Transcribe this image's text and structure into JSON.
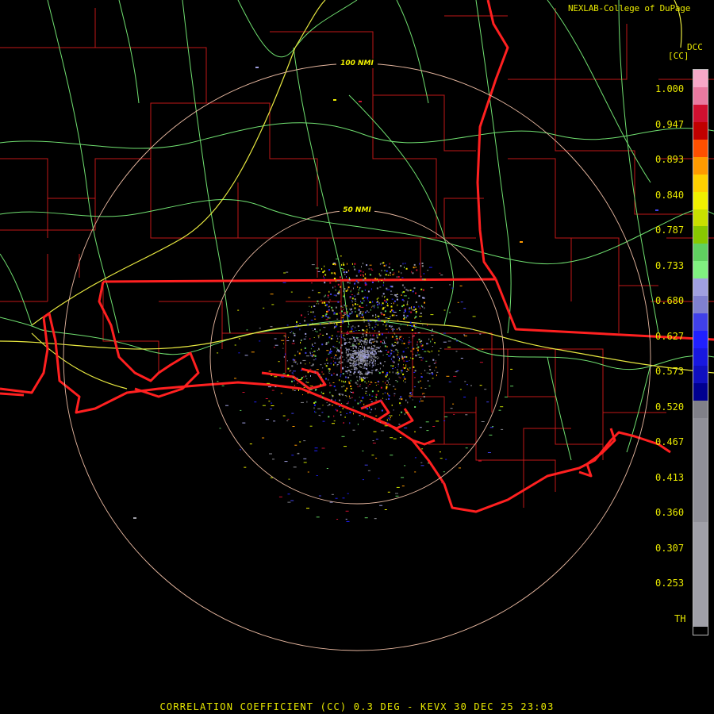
{
  "header": {
    "credit": "NEXLAB-College of DuPage",
    "site_code": "DCC",
    "unit": "[CC]"
  },
  "caption": "CORRELATION COEFFICIENT (CC) 0.3 DEG - KEVX 30 DEC 25 23:03",
  "range_rings": [
    {
      "label": "50 NMI"
    },
    {
      "label": "100 NMI"
    }
  ],
  "legend": {
    "ticks": [
      "1.000",
      "0.947",
      "0.893",
      "0.840",
      "0.787",
      "0.733",
      "0.680",
      "0.627",
      "0.573",
      "0.520",
      "0.467",
      "0.413",
      "0.360",
      "0.307",
      "0.253",
      "TH"
    ],
    "colors": [
      "#f7a8c8",
      "#e87aa0",
      "#d01030",
      "#c00000",
      "#ff5000",
      "#ff9a00",
      "#ffd000",
      "#f0f000",
      "#c8e000",
      "#88c800",
      "#60d060",
      "#80f080",
      "#a0a0e0",
      "#8080d0",
      "#4040e8",
      "#2020ff",
      "#1818e0",
      "#1010c0",
      "#000090",
      "#808088",
      "#909098",
      "#a0a0a8",
      "#000000"
    ],
    "color_bounds": [
      1.0,
      0.413
    ]
  },
  "colors": {
    "state_border": "#ff2020",
    "county_border": "#c01818",
    "highway_major": "#e8e840",
    "highway_minor": "#70e070",
    "ring": "#e8b8a0",
    "label": "#e8e800"
  }
}
